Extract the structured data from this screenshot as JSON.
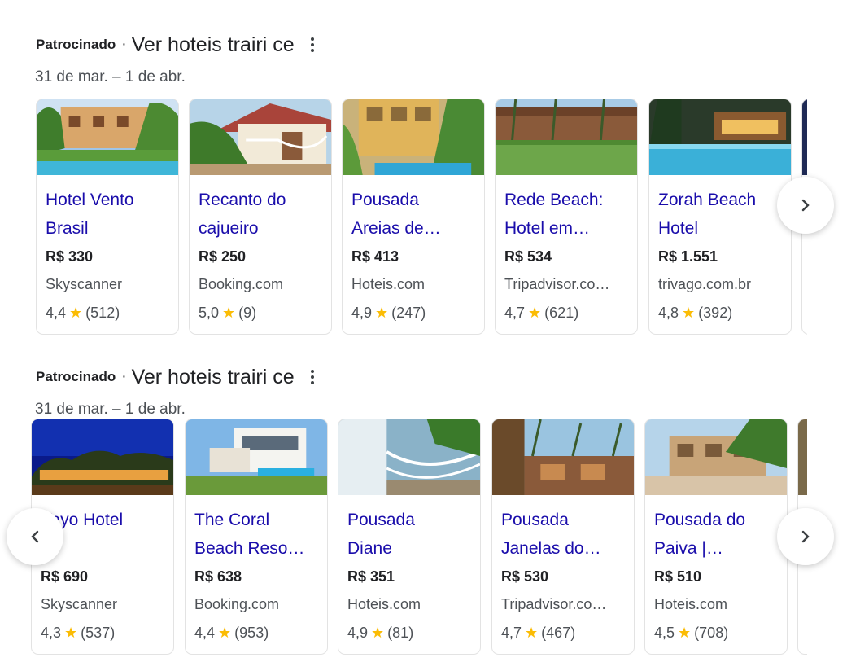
{
  "sections": [
    {
      "sponsored_label": "Patrocinado",
      "separator": "·",
      "query": "Ver hoteis trairi ce",
      "dates": "31 de mar. – 1 de abr.",
      "more_icon": "three-dots-vertical-icon",
      "nav_next_icon": "chevron-right-icon",
      "cards": [
        {
          "name_line1": "Hotel Vento",
          "name_line2": "Brasil",
          "price": "R$ 330",
          "source": "Skyscanner",
          "rating": "4,4",
          "reviews": "(512)"
        },
        {
          "name_line1": "Recanto do",
          "name_line2": "cajueiro",
          "price": "R$ 250",
          "source": "Booking.com",
          "rating": "5,0",
          "reviews": "(9)"
        },
        {
          "name_line1": "Pousada",
          "name_line2": "Areias de…",
          "price": "R$ 413",
          "source": "Hoteis.com",
          "rating": "4,9",
          "reviews": "(247)"
        },
        {
          "name_line1": "Rede Beach:",
          "name_line2": "Hotel em…",
          "price": "R$ 534",
          "source": "Tripadvisor.co…",
          "rating": "4,7",
          "reviews": "(621)"
        },
        {
          "name_line1": "Zorah Beach",
          "name_line2": "Hotel",
          "price": "R$ 1.551",
          "source": "trivago.com.br",
          "rating": "4,8",
          "reviews": "(392)"
        }
      ]
    },
    {
      "sponsored_label": "Patrocinado",
      "separator": "·",
      "query": "Ver hoteis trairi ce",
      "dates": "31 de mar. – 1 de abr.",
      "more_icon": "three-dots-vertical-icon",
      "nav_prev_icon": "chevron-left-icon",
      "nav_next_icon": "chevron-right-icon",
      "cards": [
        {
          "name_line1": "Vayo Hotel",
          "name_line2": "",
          "price": "R$ 690",
          "source": "Skyscanner",
          "rating": "4,3",
          "reviews": "(537)"
        },
        {
          "name_line1": "The Coral",
          "name_line2": "Beach Reso…",
          "price": "R$ 638",
          "source": "Booking.com",
          "rating": "4,4",
          "reviews": "(953)"
        },
        {
          "name_line1": "Pousada",
          "name_line2": "Diane",
          "price": "R$ 351",
          "source": "Hoteis.com",
          "rating": "4,9",
          "reviews": "(81)"
        },
        {
          "name_line1": "Pousada",
          "name_line2": "Janelas do…",
          "price": "R$ 530",
          "source": "Tripadvisor.co…",
          "rating": "4,7",
          "reviews": "(467)"
        },
        {
          "name_line1": "Pousada do",
          "name_line2": "Paiva |…",
          "price": "R$ 510",
          "source": "Hoteis.com",
          "rating": "4,5",
          "reviews": "(708)"
        }
      ]
    }
  ],
  "star_glyph": "★",
  "colors": {
    "link": "#1a0dab",
    "star": "#fbbc04",
    "text": "#202124",
    "muted": "#4d5156"
  }
}
